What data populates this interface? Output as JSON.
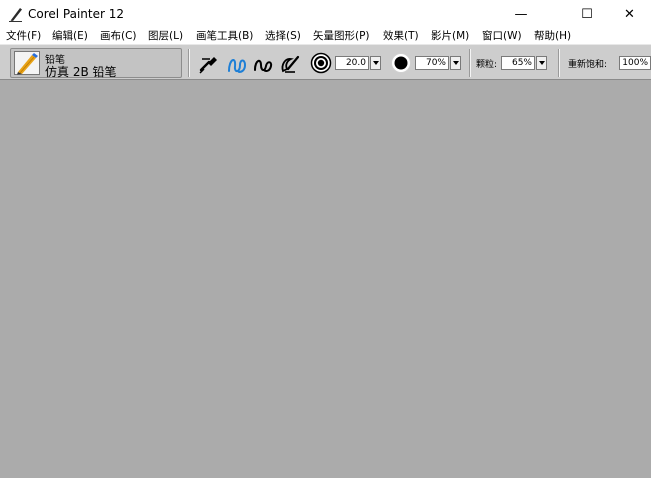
{
  "window": {
    "title": "Corel Painter 12",
    "minimize_glyph": "—",
    "maximize_glyph": "☐",
    "close_glyph": "✕"
  },
  "menu": [
    {
      "label": "文件(F)"
    },
    {
      "label": "编辑(E)"
    },
    {
      "label": "画布(C)"
    },
    {
      "label": "图层(L)"
    },
    {
      "label": "画笔工具(B)"
    },
    {
      "label": "选择(S)"
    },
    {
      "label": "矢量图形(P)"
    },
    {
      "label": "效果(T)"
    },
    {
      "label": "影片(M)"
    },
    {
      "label": "窗口(W)"
    },
    {
      "label": "帮助(H)"
    }
  ],
  "brush": {
    "category": "铅笔",
    "variant": "仿真 2B 铅笔"
  },
  "properties": {
    "size_value": "20.0",
    "opacity_value": "70%",
    "grain_label": "颗粒:",
    "grain_value": "65%",
    "resaturation_label": "重新饱和:",
    "resaturation_value": "100%"
  },
  "icons": {
    "app": "pencil-logo-icon",
    "brush": "pencil-brush-icon",
    "tools": [
      "dropper-brush-icon",
      "stroke-curve-icon",
      "stroke-loop-icon",
      "brush-tracking-icon"
    ],
    "size": "size-target-icon",
    "opacity": "opacity-dot-icon"
  },
  "colors": {
    "canvas_bg": "#ababab",
    "property_bar": "#cdcdcd",
    "accent_blue": "#1e7fd6"
  }
}
